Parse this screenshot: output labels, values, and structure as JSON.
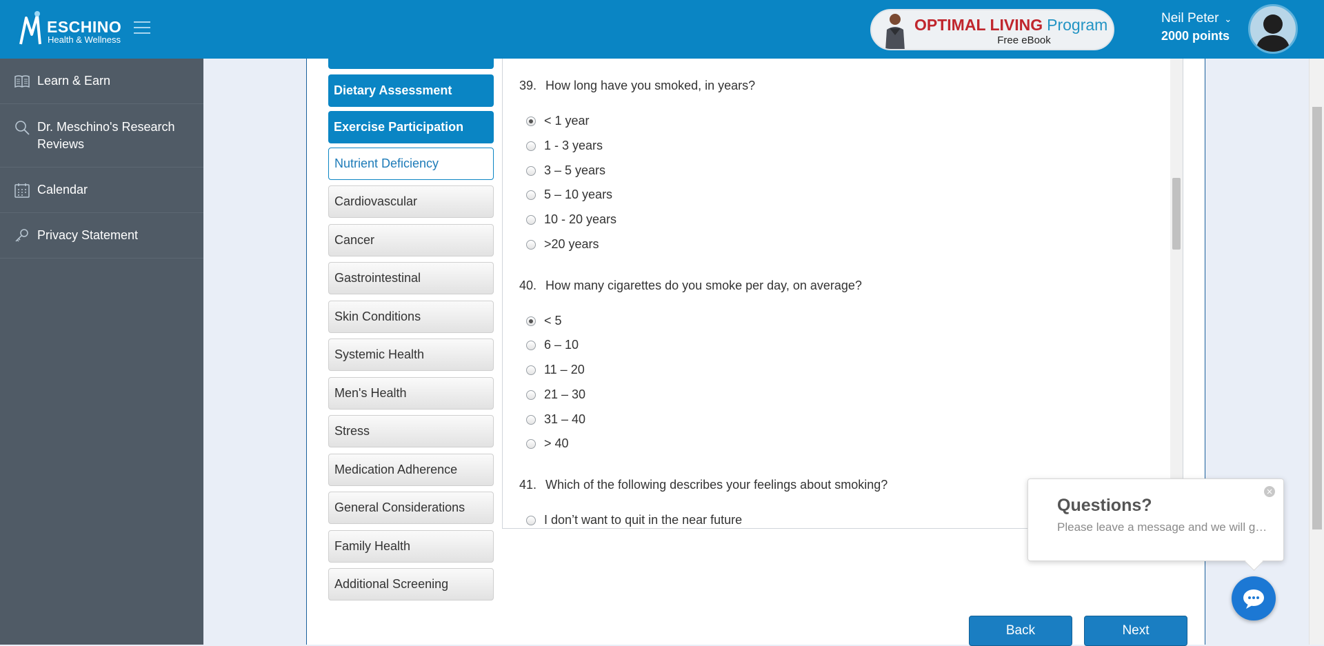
{
  "header": {
    "brand": "ESCHINO",
    "tagline": "Health & Wellness",
    "promo_title": "OPTIMAL LIVING",
    "promo_title_suffix": "Program",
    "promo_subtitle": "Free eBook",
    "user_name": "Neil Peter",
    "user_points": "2000 points"
  },
  "sidebar": {
    "items": [
      {
        "label": "Learn & Earn",
        "icon": "book-icon"
      },
      {
        "label": "Dr. Meschino's Research Reviews",
        "icon": "search-icon"
      },
      {
        "label": "Calendar",
        "icon": "calendar-icon"
      },
      {
        "label": "Privacy Statement",
        "icon": "key-icon"
      }
    ]
  },
  "categories": [
    {
      "label": "Dietary Assessment",
      "state": "done"
    },
    {
      "label": "Exercise Participation",
      "state": "done"
    },
    {
      "label": "Nutrient Deficiency",
      "state": "current"
    },
    {
      "label": "Cardiovascular",
      "state": "todo"
    },
    {
      "label": "Cancer",
      "state": "todo"
    },
    {
      "label": "Gastrointestinal",
      "state": "todo"
    },
    {
      "label": "Skin Conditions",
      "state": "todo"
    },
    {
      "label": "Systemic Health",
      "state": "todo"
    },
    {
      "label": "Men's Health",
      "state": "todo"
    },
    {
      "label": "Stress",
      "state": "todo"
    },
    {
      "label": "Medication Adherence",
      "state": "todo"
    },
    {
      "label": "General Considerations",
      "state": "todo"
    },
    {
      "label": "Family Health",
      "state": "todo"
    },
    {
      "label": "Additional Screening",
      "state": "todo"
    }
  ],
  "questions": [
    {
      "number": "39.",
      "text": "How long have you smoked, in years?",
      "options": [
        "< 1 year",
        "1 - 3 years",
        "3 – 5 years",
        "5 – 10 years",
        "10 - 20 years",
        ">20 years"
      ],
      "selected": 0
    },
    {
      "number": "40.",
      "text": "How many cigarettes do you smoke per day, on average?",
      "options": [
        "< 5",
        "6 – 10",
        "11 – 20",
        "21 – 30",
        "31 – 40",
        "> 40"
      ],
      "selected": 0
    },
    {
      "number": "41.",
      "text": "Which of the following describes your feelings about smoking?",
      "options": [
        "I don’t want to quit in the near future"
      ],
      "selected": -1
    }
  ],
  "buttons": {
    "back": "Back",
    "next": "Next"
  },
  "chat": {
    "title": "Questions?",
    "message": "Please leave a message and we will get back to you."
  },
  "colors": {
    "header": "#0a85c4",
    "sidebar": "#505b66",
    "accent": "#1a7ec2",
    "promo_red": "#c0262d"
  }
}
